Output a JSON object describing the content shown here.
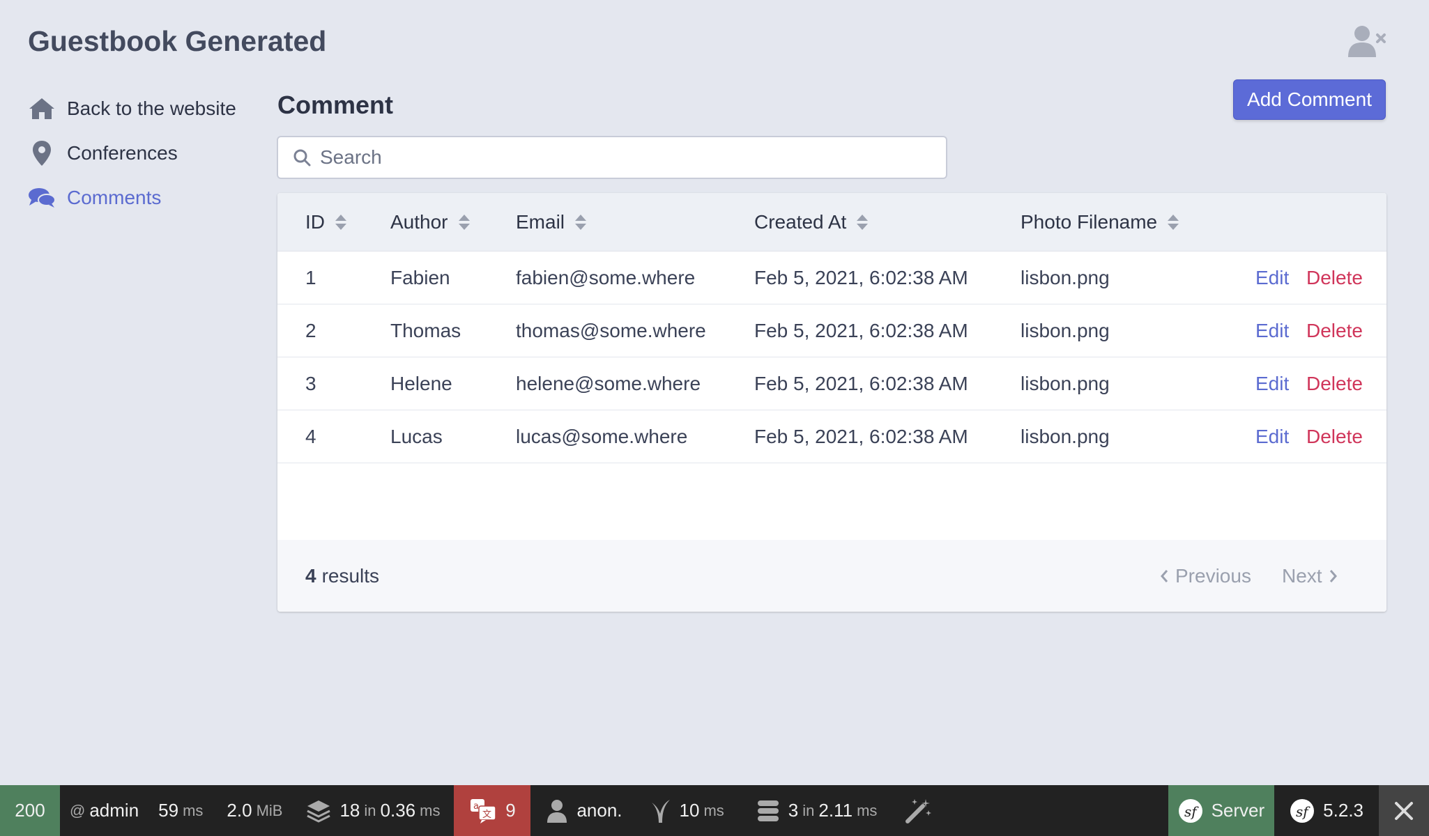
{
  "app": {
    "title": "Guestbook Generated",
    "user_menu_icon": "user-times-icon"
  },
  "sidebar": {
    "items": [
      {
        "label": "Back to the website",
        "icon": "home-icon",
        "active": false
      },
      {
        "label": "Conferences",
        "icon": "map-marker-icon",
        "active": false
      },
      {
        "label": "Comments",
        "icon": "comments-icon",
        "active": true
      }
    ]
  },
  "main": {
    "title": "Comment",
    "add_button": "Add Comment",
    "search_placeholder": "Search"
  },
  "table": {
    "columns": [
      "ID",
      "Author",
      "Email",
      "Created At",
      "Photo Filename"
    ],
    "rows": [
      {
        "id": "1",
        "author": "Fabien",
        "email": "fabien@some.where",
        "created_at": "Feb 5, 2021, 6:02:38 AM",
        "photo": "lisbon.png",
        "edit": "Edit",
        "delete": "Delete"
      },
      {
        "id": "2",
        "author": "Thomas",
        "email": "thomas@some.where",
        "created_at": "Feb 5, 2021, 6:02:38 AM",
        "photo": "lisbon.png",
        "edit": "Edit",
        "delete": "Delete"
      },
      {
        "id": "3",
        "author": "Helene",
        "email": "helene@some.where",
        "created_at": "Feb 5, 2021, 6:02:38 AM",
        "photo": "lisbon.png",
        "edit": "Edit",
        "delete": "Delete"
      },
      {
        "id": "4",
        "author": "Lucas",
        "email": "lucas@some.where",
        "created_at": "Feb 5, 2021, 6:02:38 AM",
        "photo": "lisbon.png",
        "edit": "Edit",
        "delete": "Delete"
      }
    ],
    "results_count": "4",
    "results_label": "results",
    "previous": "Previous",
    "next": "Next"
  },
  "toolbar": {
    "status_code": "200",
    "at": "@",
    "user": "admin",
    "time_value": "59",
    "time_unit": "ms",
    "memory_value": "2.0",
    "memory_unit": "MiB",
    "forms_count": "18",
    "forms_in": "in",
    "forms_time": "0.36",
    "forms_unit": "ms",
    "translation_count": "9",
    "security_user": "anon.",
    "twig_time": "10",
    "twig_unit": "ms",
    "db_count": "3",
    "db_in": "in",
    "db_time": "2.11",
    "db_unit": "ms",
    "server_label": "Server",
    "symfony_version": "5.2.3",
    "colors": {
      "success": "#4f805d",
      "error": "#b0413e",
      "bar": "#222222"
    }
  }
}
